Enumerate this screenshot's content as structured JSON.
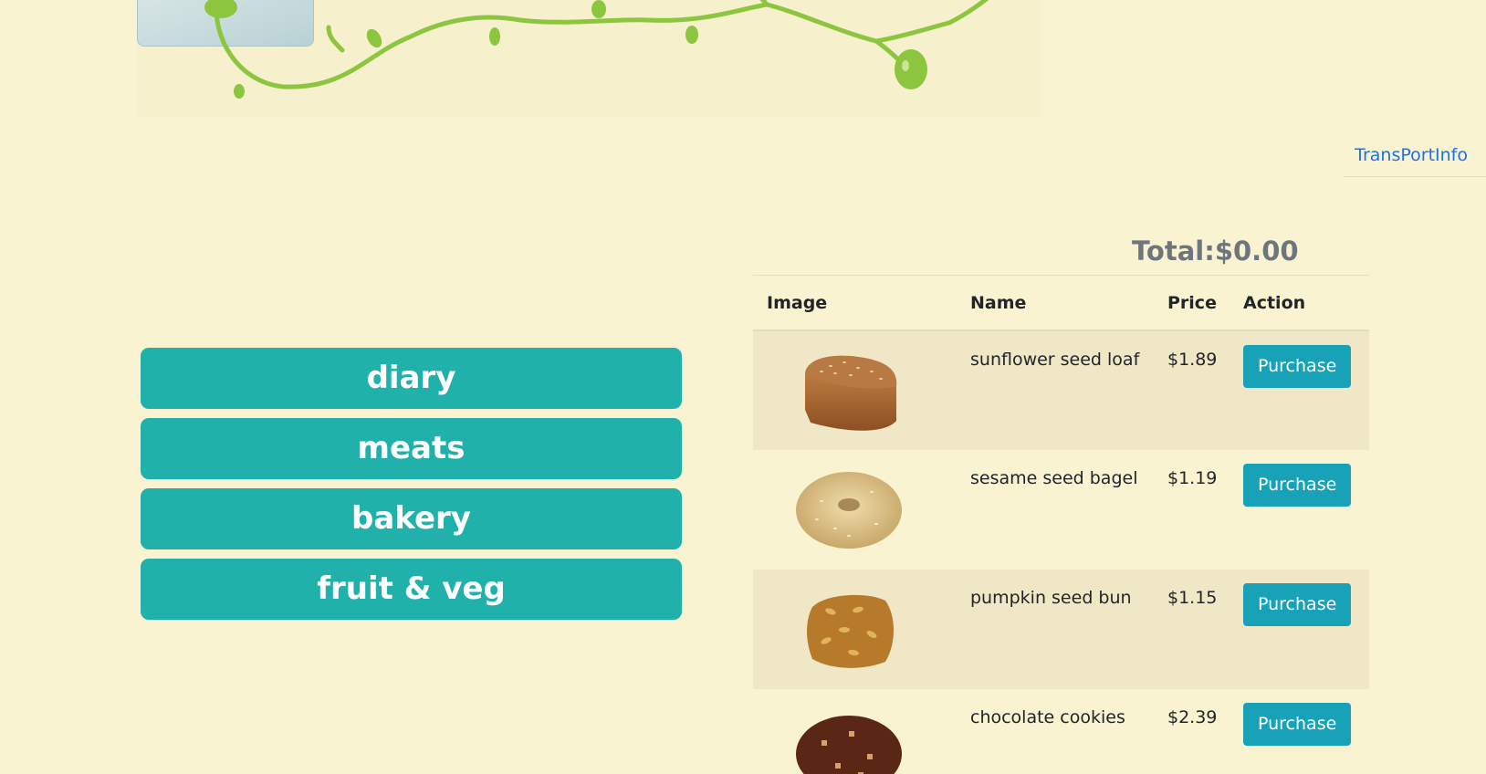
{
  "nav": {
    "transport_link": "TransPortInfo"
  },
  "categories": [
    {
      "label": "diary"
    },
    {
      "label": "meats"
    },
    {
      "label": "bakery"
    },
    {
      "label": "fruit & veg"
    }
  ],
  "cart": {
    "total_label": "Total:$0.00"
  },
  "table": {
    "headers": [
      "Image",
      "Name",
      "Price",
      "Action"
    ],
    "rows": [
      {
        "image": "sunflower-seed-loaf-image",
        "name": "sunflower seed loaf",
        "price": "$1.89",
        "action": "Purchase"
      },
      {
        "image": "sesame-seed-bagel-image",
        "name": "sesame seed bagel",
        "price": "$1.19",
        "action": "Purchase"
      },
      {
        "image": "pumpkin-seed-bun-image",
        "name": "pumpkin seed bun",
        "price": "$1.15",
        "action": "Purchase"
      },
      {
        "image": "chocolate-cookies-image",
        "name": "chocolate cookies",
        "price": "$2.39",
        "action": "Purchase"
      }
    ]
  },
  "colors": {
    "background": "#f9f3d1",
    "category_button": "#20b1ab",
    "purchase_button": "#17a2b8",
    "link": "#1a73e8",
    "vine": "#8cc63f"
  }
}
